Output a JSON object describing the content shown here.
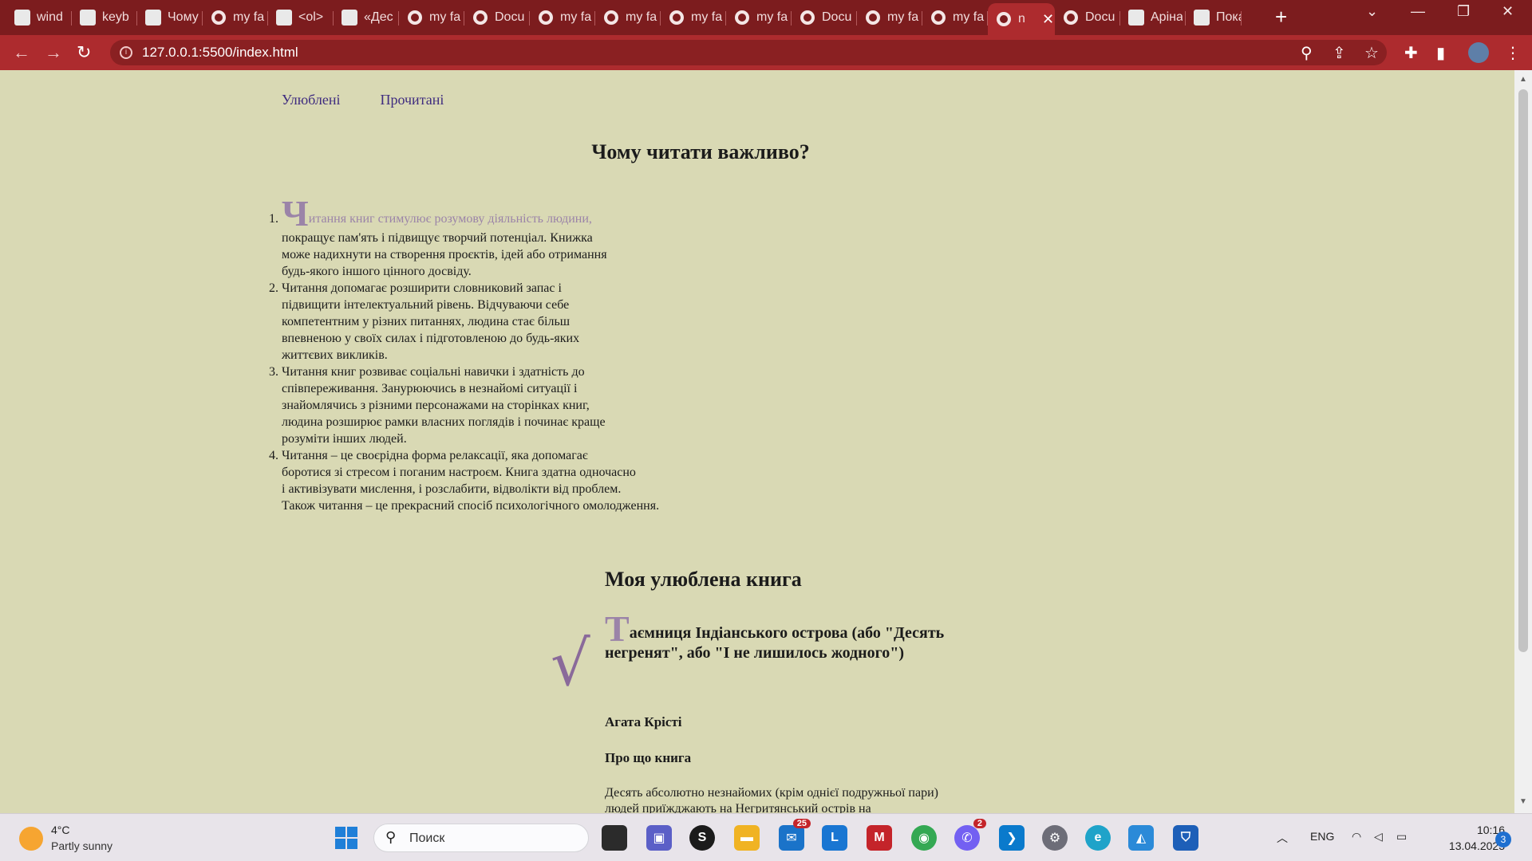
{
  "browser": {
    "tabs": [
      {
        "title": "wind",
        "icon": "doc-icon"
      },
      {
        "title": "keyb",
        "icon": "vscode-icon"
      },
      {
        "title": "Чому",
        "icon": "bird-icon"
      },
      {
        "title": "my fa",
        "icon": "globe-icon"
      },
      {
        "title": "<ol>",
        "icon": "m-icon"
      },
      {
        "title": "«Дес",
        "icon": "d-icon"
      },
      {
        "title": "my fa",
        "icon": "globe-icon"
      },
      {
        "title": "Docu",
        "icon": "globe-icon"
      },
      {
        "title": "my fa",
        "icon": "globe-icon"
      },
      {
        "title": "my fa",
        "icon": "globe-icon"
      },
      {
        "title": "my fa",
        "icon": "globe-icon"
      },
      {
        "title": "my fa",
        "icon": "globe-icon"
      },
      {
        "title": "Docu",
        "icon": "globe-icon"
      },
      {
        "title": "my fa",
        "icon": "globe-icon"
      },
      {
        "title": "my fa",
        "icon": "globe-icon"
      },
      {
        "title": "n",
        "icon": "globe-icon",
        "active": true
      },
      {
        "title": "Docu",
        "icon": "globe-icon"
      },
      {
        "title": "Аріна",
        "icon": "github-icon"
      },
      {
        "title": "Пока",
        "icon": "nu-icon"
      }
    ],
    "url": "127.0.0.1:5500/index.html"
  },
  "page": {
    "nav": [
      "Улюблені",
      "Прочитані"
    ],
    "why_heading": "Чому читати важливо?",
    "reasons": [
      {
        "dropcap": "Ч",
        "first_line": "итання книг стимулює розумову діяльність людини,",
        "lines": [
          "покращує пам'ять і підвищує творчий потенціал. Книжка",
          "може надихнути на створення проєктів, ідей або отримання",
          "будь-якого іншого цінного досвіду."
        ]
      },
      {
        "lines": [
          "Читання допомагає розширити словниковий запас і",
          "підвищити інтелектуальний рівень. Відчуваючи себе",
          "компетентним у різних питаннях, людина стає більш",
          "впевненою у своїх силах і підготовленою до будь-яких",
          "життєвих викликів."
        ]
      },
      {
        "lines": [
          "Читання книг розвиває соціальні навички і здатність до",
          "співпереживання. Занурюючись в незнайомі ситуації і",
          "знайомлячись з різними персонажами на сторінках книг,",
          "людина розширює рамки власних поглядів і починає краще",
          "розуміти інших людей."
        ]
      },
      {
        "lines": [
          "Читання – це своєрідна форма релаксації, яка допомагає",
          "боротися зі стресом і поганим настроєм. Книга здатна одночасно",
          "і активізувати мислення, і розслабити, відволікти від проблем.",
          "Також читання – це прекрасний спосіб психологічного омолодження."
        ]
      }
    ],
    "fav_heading": "Моя улюблена книга",
    "book": {
      "dropcap": "Т",
      "title_rest": "аємниця Індіанського острова (або \"Десять негренят\", або \"І не лишилось жодного\")",
      "author": "Агата Крісті",
      "about_heading": "Про що книга",
      "about_text": "Десять абсолютно незнайомих (крім однієї подружньої пари) людей приїжджають на Негритянський острів на"
    },
    "checkmark": "√"
  },
  "taskbar": {
    "weather_temp": "4°C",
    "weather_desc": "Partly sunny",
    "search_placeholder": "Поиск",
    "mail_badge": "25",
    "viber_badge": "2",
    "lang": "ENG",
    "time": "10:16",
    "date": "13.04.2023",
    "notifications": "3"
  }
}
